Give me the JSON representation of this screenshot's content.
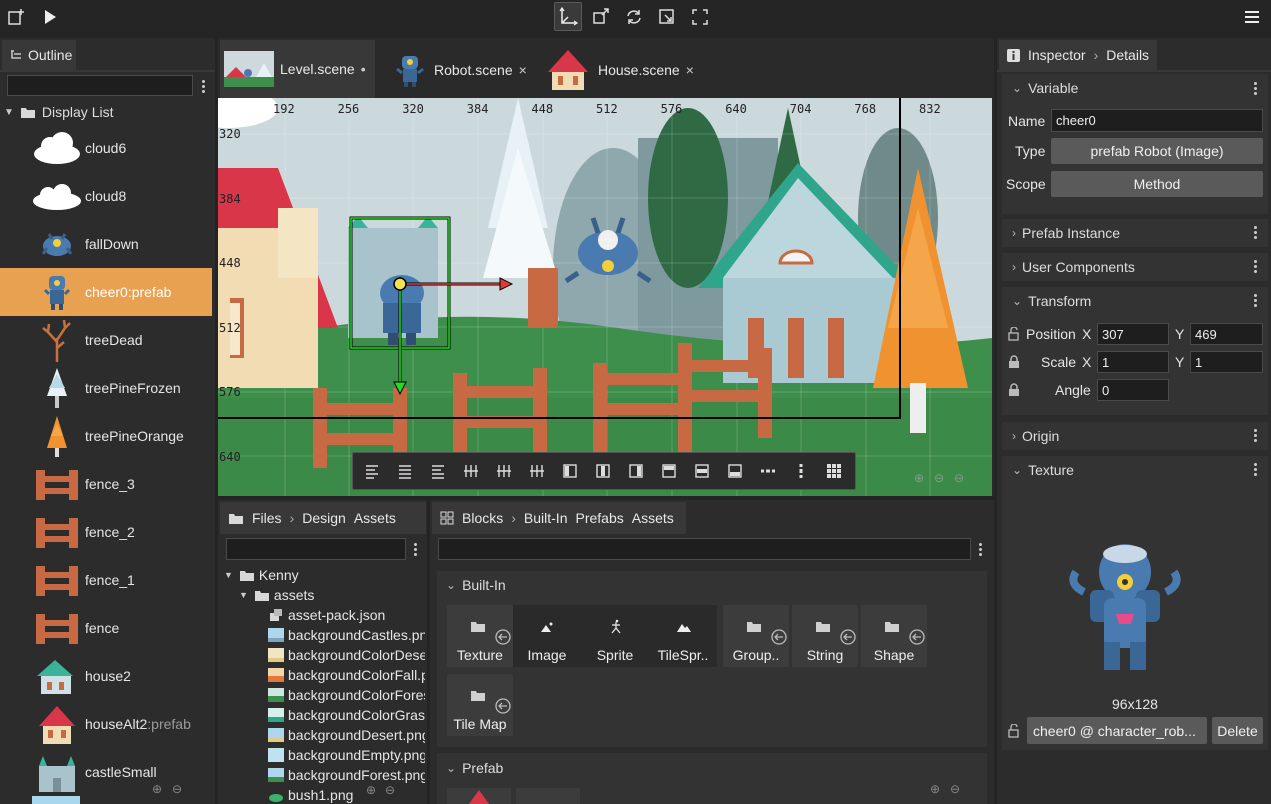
{
  "toolbar": {
    "left_icons": [
      "new-scene-icon",
      "play-icon"
    ],
    "center_icons": [
      "select-tool-icon",
      "scale-tool-icon",
      "rotate-tool-icon",
      "resize-tool-icon",
      "fullscreen-icon"
    ],
    "menu_icon": "hamburger-menu-icon"
  },
  "outline": {
    "tab_label": "Outline",
    "filter_placeholder": "",
    "root_label": "Display List",
    "items": [
      {
        "label": "cloud6",
        "suffix": ""
      },
      {
        "label": "cloud8",
        "suffix": ""
      },
      {
        "label": "fallDown",
        "suffix": ""
      },
      {
        "label": "cheer0",
        "suffix": ":prefab",
        "selected": true
      },
      {
        "label": "treeDead",
        "suffix": ""
      },
      {
        "label": "treePineFrozen",
        "suffix": ""
      },
      {
        "label": "treePineOrange",
        "suffix": ""
      },
      {
        "label": "fence_3",
        "suffix": ""
      },
      {
        "label": "fence_2",
        "suffix": ""
      },
      {
        "label": "fence_1",
        "suffix": ""
      },
      {
        "label": "fence",
        "suffix": ""
      },
      {
        "label": "house2",
        "suffix": ""
      },
      {
        "label": "houseAlt2",
        "suffix": ":prefab"
      },
      {
        "label": "castleSmall",
        "suffix": ""
      }
    ]
  },
  "editor_tabs": [
    {
      "label": "Level.scene",
      "modified_mark": "•",
      "active": true
    },
    {
      "label": "Robot.scene",
      "close": "×"
    },
    {
      "label": "House.scene",
      "close": "×"
    }
  ],
  "scene": {
    "ruler_x": [
      "192",
      "256",
      "320",
      "384",
      "448",
      "512",
      "576",
      "640",
      "704",
      "768",
      "832"
    ],
    "ruler_y": [
      "320",
      "384",
      "448",
      "512",
      "576",
      "640"
    ],
    "align_toolbar_icons": [
      "align-left-icon",
      "align-center-icon",
      "align-right-icon",
      "distribute-left-icon",
      "distribute-center-icon",
      "distribute-right-icon",
      "align-box-left-icon",
      "align-box-center-icon",
      "align-box-right-icon",
      "align-top-icon",
      "align-middle-icon",
      "align-bottom-icon",
      "horizontal-row-icon",
      "vertical-column-icon",
      "grid-icon"
    ]
  },
  "files": {
    "tab_label": "Files",
    "breadcrumb": [
      "Design",
      "Assets"
    ],
    "filter_placeholder": "",
    "tree": [
      {
        "label": "Kenny",
        "type": "folder",
        "level": 0
      },
      {
        "label": "assets",
        "type": "folder",
        "level": 1
      },
      {
        "label": "asset-pack.json",
        "type": "pack",
        "level": 2
      },
      {
        "label": "backgroundCastles.png",
        "type": "image",
        "level": 2
      },
      {
        "label": "backgroundColorDesert.png",
        "type": "image",
        "level": 2
      },
      {
        "label": "backgroundColorFall.png",
        "type": "image",
        "level": 2
      },
      {
        "label": "backgroundColorForest.png",
        "type": "image",
        "level": 2
      },
      {
        "label": "backgroundColorGrass.png",
        "type": "image",
        "level": 2
      },
      {
        "label": "backgroundDesert.png",
        "type": "image",
        "level": 2
      },
      {
        "label": "backgroundEmpty.png",
        "type": "image",
        "level": 2
      },
      {
        "label": "backgroundForest.png",
        "type": "image",
        "level": 2
      },
      {
        "label": "bush1.png",
        "type": "image",
        "level": 2
      }
    ]
  },
  "blocks": {
    "tab_label": "Blocks",
    "breadcrumb": [
      "Built-In",
      "Prefabs",
      "Assets"
    ],
    "filter_placeholder": "",
    "builtin_section": "Built-In",
    "prefab_section": "Prefab",
    "items": [
      {
        "label": "Texture",
        "icon": "folder-icon",
        "arrow": true,
        "dark": false
      },
      {
        "label": "Image",
        "icon": "image-icon",
        "arrow": false,
        "dark": true
      },
      {
        "label": "Sprite",
        "icon": "sprite-icon",
        "arrow": false,
        "dark": true
      },
      {
        "label": "TileSpr..",
        "icon": "tilesprite-icon",
        "arrow": false,
        "dark": true
      },
      {
        "label": "Group..",
        "icon": "folder-icon",
        "arrow": true,
        "dark": false
      },
      {
        "label": "String",
        "icon": "folder-icon",
        "arrow": true,
        "dark": false
      },
      {
        "label": "Shape",
        "icon": "folder-icon",
        "arrow": true,
        "dark": false
      },
      {
        "label": "Tile Map",
        "icon": "folder-icon",
        "arrow": true,
        "dark": false
      }
    ]
  },
  "inspector": {
    "tab_label": "Inspector",
    "breadcrumb": "Details",
    "variable": {
      "title": "Variable",
      "name_label": "Name",
      "name_value": "cheer0",
      "type_label": "Type",
      "type_value": "prefab Robot (Image)",
      "scope_label": "Scope",
      "scope_value": "Method"
    },
    "sections": [
      "Prefab Instance",
      "User Components"
    ],
    "transform": {
      "title": "Transform",
      "position_label": "Position",
      "pos_x": "307",
      "pos_y": "469",
      "scale_label": "Scale",
      "scale_x": "1",
      "scale_y": "1",
      "angle_label": "Angle",
      "angle": "0",
      "x_label": "X",
      "y_label": "Y"
    },
    "origin_title": "Origin",
    "texture": {
      "title": "Texture",
      "size": "96x128",
      "frame_value": "cheer0 @ character_rob...",
      "delete_label": "Delete"
    }
  },
  "colors": {
    "selection": "#e8a051",
    "panel": "#2c2c2c",
    "tab": "#383838",
    "sky": "#cbd8dc",
    "grass": "#3f8f4c"
  }
}
